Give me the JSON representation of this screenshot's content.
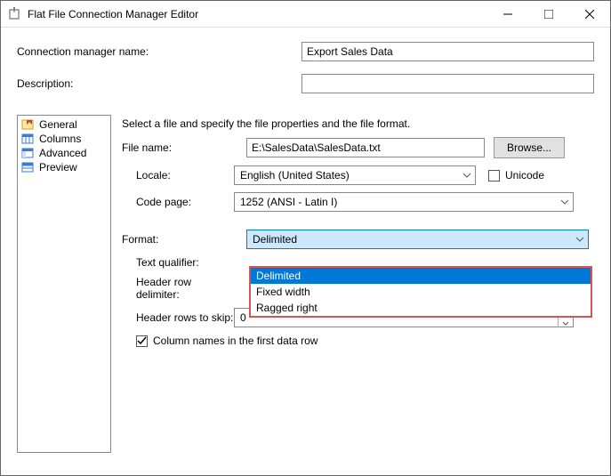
{
  "window": {
    "title": "Flat File Connection Manager Editor"
  },
  "fields": {
    "conn_name_label": "Connection manager name:",
    "conn_name_value": "Export Sales Data",
    "desc_label": "Description:",
    "desc_value": ""
  },
  "sidebar": {
    "items": [
      {
        "label": "General"
      },
      {
        "label": "Columns"
      },
      {
        "label": "Advanced"
      },
      {
        "label": "Preview"
      }
    ]
  },
  "content": {
    "instruction": "Select a file and specify the file properties and the file format.",
    "file_name_label": "File name:",
    "file_name_value": "E:\\SalesData\\SalesData.txt",
    "browse_label": "Browse...",
    "locale_label": "Locale:",
    "locale_value": "English (United States)",
    "unicode_label": "Unicode",
    "unicode_checked": false,
    "codepage_label": "Code page:",
    "codepage_value": "1252  (ANSI - Latin I)",
    "format_label": "Format:",
    "format_value": "Delimited",
    "text_qualifier_label": "Text qualifier:",
    "header_delim_label": "Header row delimiter:",
    "header_skip_label": "Header rows to skip:",
    "header_skip_value": "0",
    "colnames_label": "Column names in the first data row",
    "colnames_checked": true
  },
  "dropdown": {
    "items": [
      {
        "label": "Delimited",
        "selected": true
      },
      {
        "label": "Fixed width",
        "selected": false
      },
      {
        "label": "Ragged right",
        "selected": false
      }
    ]
  }
}
